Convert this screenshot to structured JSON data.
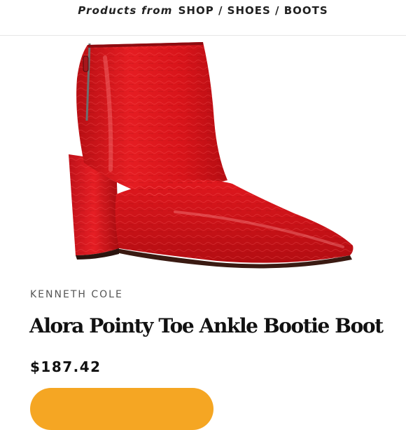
{
  "breadcrumb": {
    "prefix": "Products from",
    "path": "SHOP / SHOES / BOOTS"
  },
  "product": {
    "brand": "KENNETH COLE",
    "title": "Alora Pointy Toe Ankle Bootie Boot",
    "price": "$187.42",
    "image_subject": "red patent leather pointy toe ankle bootie with block heel",
    "color": "#d8141a"
  },
  "colors": {
    "accent_button": "#f5a623",
    "boot_red": "#d8141a"
  }
}
